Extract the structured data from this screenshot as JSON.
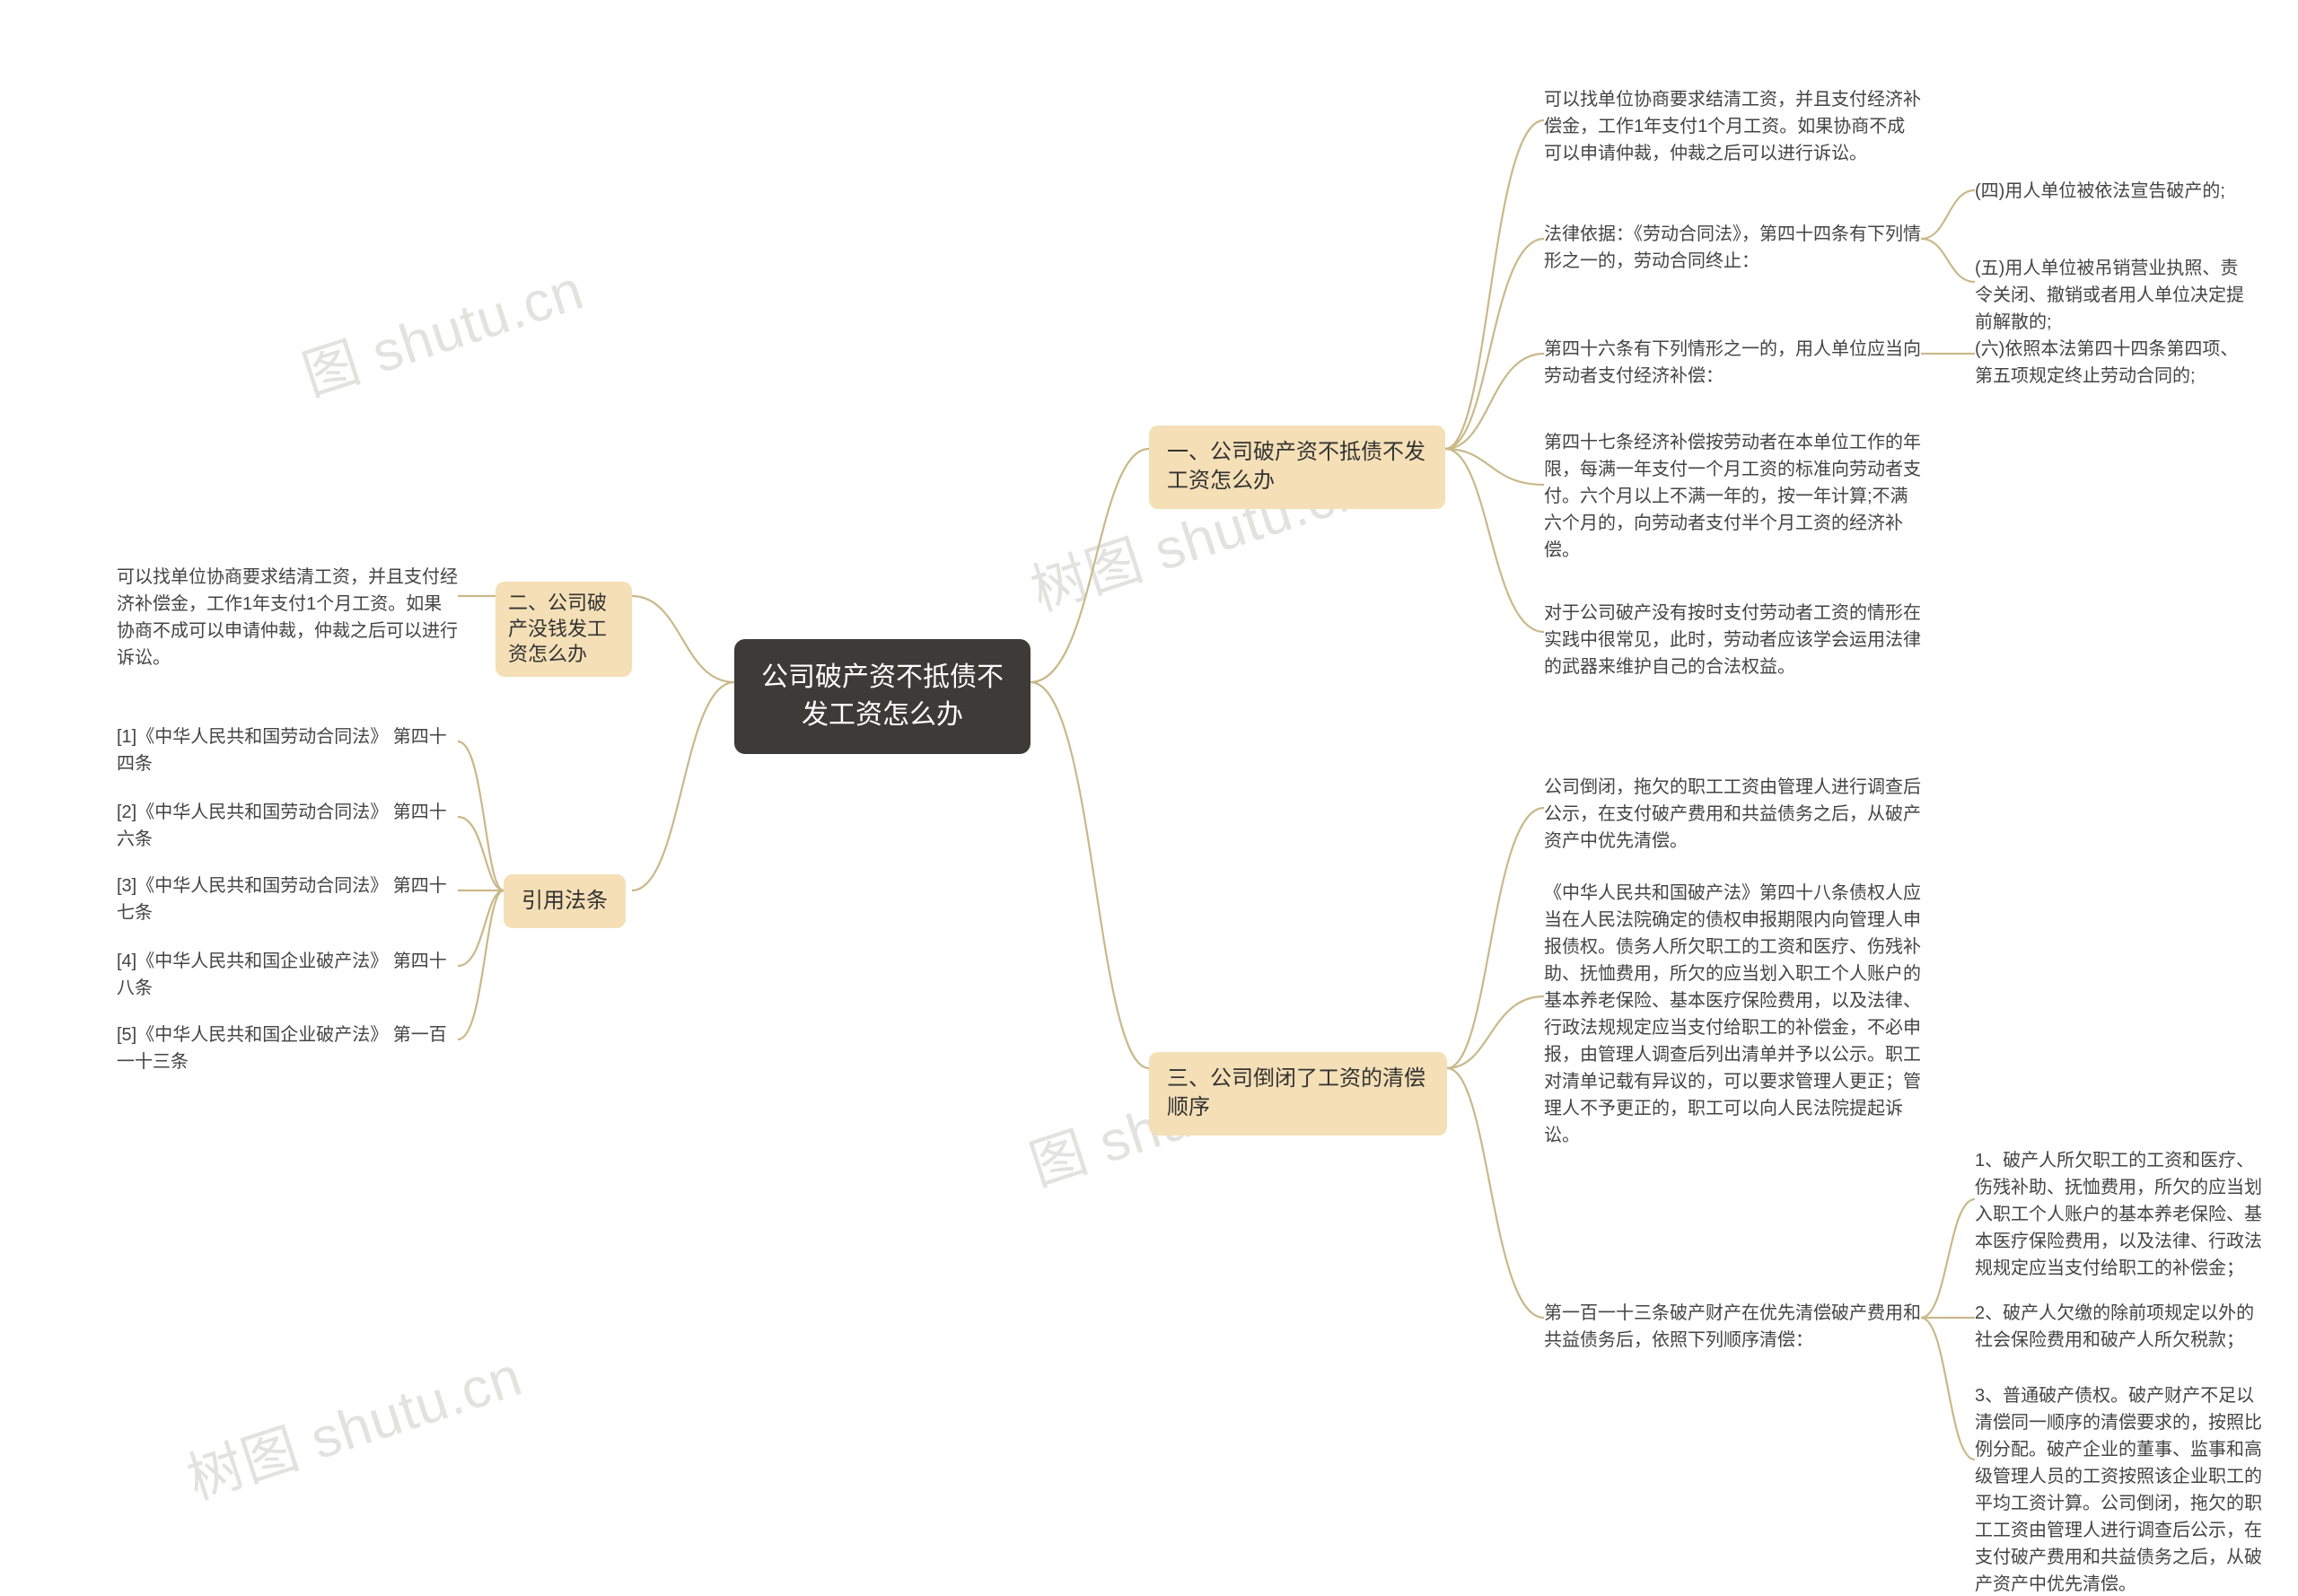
{
  "watermarks": [
    "图 shutu.cn",
    "树图 shutu.cn",
    "图 shutu.cn",
    "树图 shutu.cn"
  ],
  "root": "公司破产资不抵债不发工资怎么办",
  "s2": {
    "label": "二、公司破产没钱发工资怎么办",
    "leaf": "可以找单位协商要求结清工资，并且支付经济补偿金，工作1年支付1个月工资。如果协商不成可以申请仲裁，仲裁之后可以进行诉讼。"
  },
  "ref": {
    "label": "引用法条",
    "items": [
      "[1]《中华人民共和国劳动合同法》 第四十四条",
      "[2]《中华人民共和国劳动合同法》 第四十六条",
      "[3]《中华人民共和国劳动合同法》 第四十七条",
      "[4]《中华人民共和国企业破产法》 第四十八条",
      "[5]《中华人民共和国企业破产法》 第一百一十三条"
    ]
  },
  "s1": {
    "label": "一、公司破产资不抵债不发工资怎么办",
    "a": "可以找单位协商要求结清工资，并且支付经济补偿金，工作1年支付1个月工资。如果协商不成可以申请仲裁，仲裁之后可以进行诉讼。",
    "b": "法律依据：《劳动合同法》，第四十四条有下列情形之一的，劳动合同终止：",
    "b1": "(四)用人单位被依法宣告破产的;",
    "b2": "(五)用人单位被吊销营业执照、责令关闭、撤销或者用人单位决定提前解散的;",
    "c": "第四十六条有下列情形之一的，用人单位应当向劳动者支付经济补偿：",
    "c1": "(六)依照本法第四十四条第四项、第五项规定终止劳动合同的;",
    "d": "第四十七条经济补偿按劳动者在本单位工作的年限，每满一年支付一个月工资的标准向劳动者支付。六个月以上不满一年的，按一年计算;不满六个月的，向劳动者支付半个月工资的经济补偿。",
    "e": "对于公司破产没有按时支付劳动者工资的情形在实践中很常见，此时，劳动者应该学会运用法律的武器来维护自己的合法权益。"
  },
  "s3": {
    "label": "三、公司倒闭了工资的清偿顺序",
    "a": "公司倒闭，拖欠的职工工资由管理人进行调查后公示，在支付破产费用和共益债务之后，从破产资产中优先清偿。",
    "b": "《中华人民共和国破产法》第四十八条债权人应当在人民法院确定的债权申报期限内向管理人申报债权。债务人所欠职工的工资和医疗、伤残补助、抚恤费用，所欠的应当划入职工个人账户的基本养老保险、基本医疗保险费用，以及法律、行政法规规定应当支付给职工的补偿金，不必申报，由管理人调查后列出清单并予以公示。职工对清单记载有异议的，可以要求管理人更正；管理人不予更正的，职工可以向人民法院提起诉讼。",
    "c": "第一百一十三条破产财产在优先清偿破产费用和共益债务后，依照下列顺序清偿：",
    "c1": "1、破产人所欠职工的工资和医疗、伤残补助、抚恤费用，所欠的应当划入职工个人账户的基本养老保险、基本医疗保险费用，以及法律、行政法规规定应当支付给职工的补偿金；",
    "c2": "2、破产人欠缴的除前项规定以外的社会保险费用和破产人所欠税款；",
    "c3": "3、普通破产债权。破产财产不足以清偿同一顺序的清偿要求的，按照比例分配。破产企业的董事、监事和高级管理人员的工资按照该企业职工的平均工资计算。公司倒闭，拖欠的职工工资由管理人进行调查后公示，在支付破产费用和共益债务之后，从破产资产中优先清偿。"
  }
}
